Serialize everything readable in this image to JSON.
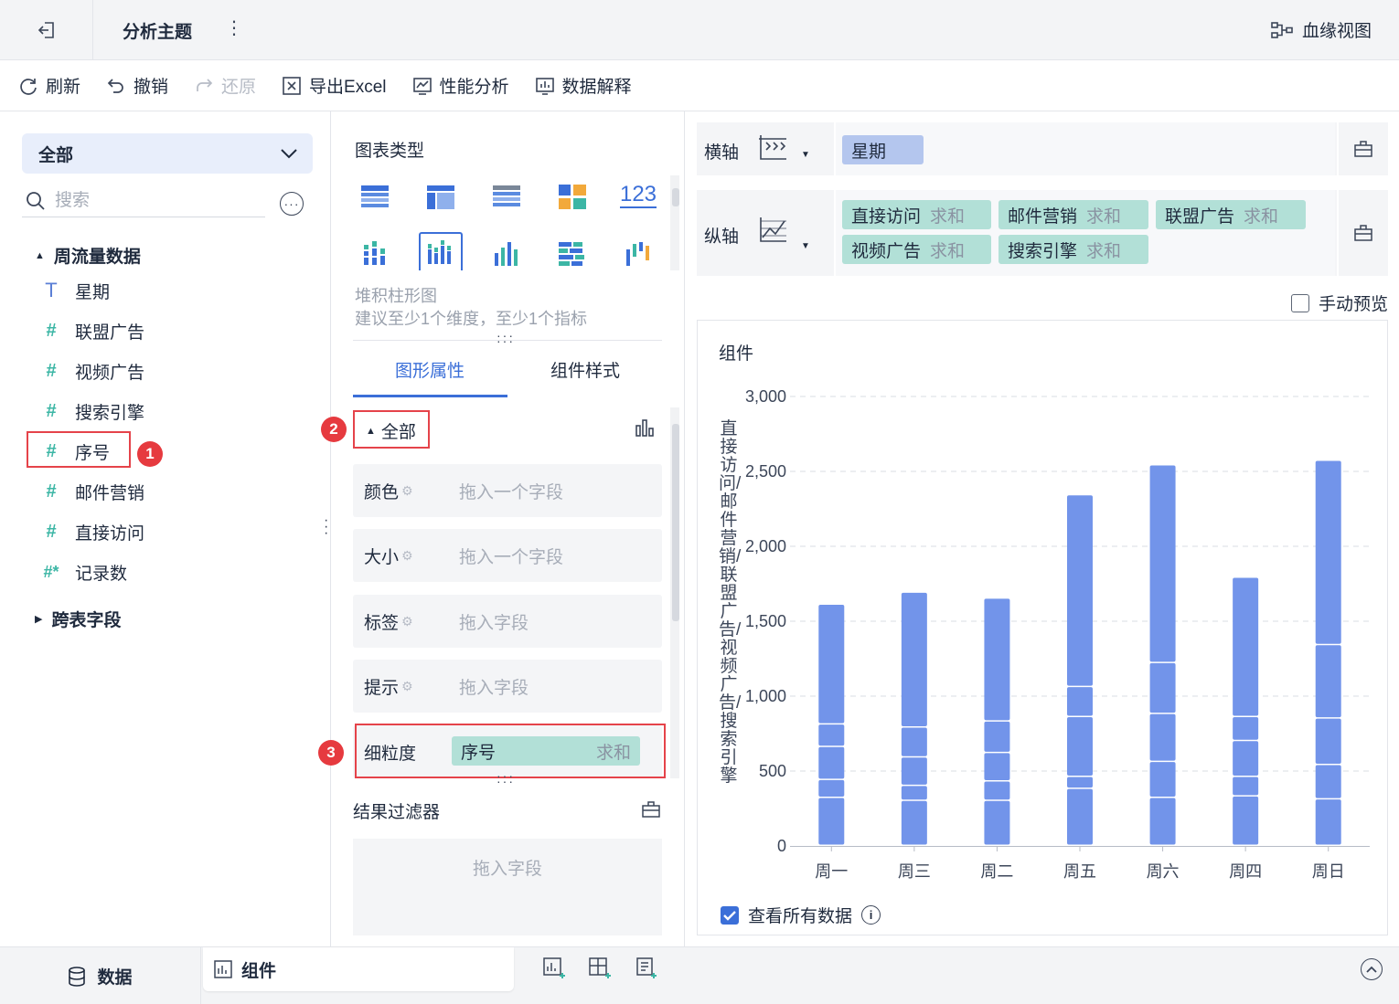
{
  "header": {
    "title": "分析主题",
    "more": "⋮",
    "lineage_label": "血缘视图"
  },
  "toolbar": {
    "refresh": "刷新",
    "undo": "撤销",
    "redo": "还原",
    "export": "导出Excel",
    "perf": "性能分析",
    "explain": "数据解释"
  },
  "left": {
    "scope": "全部",
    "search_placeholder": "搜索",
    "group1": "周流量数据",
    "fields": [
      {
        "icon": "T",
        "label": "星期"
      },
      {
        "icon": "#",
        "label": "联盟广告"
      },
      {
        "icon": "#",
        "label": "视频广告"
      },
      {
        "icon": "#",
        "label": "搜索引擎"
      },
      {
        "icon": "#",
        "label": "序号"
      },
      {
        "icon": "#",
        "label": "邮件营销"
      },
      {
        "icon": "#",
        "label": "直接访问"
      },
      {
        "icon": "#*",
        "label": "记录数"
      }
    ],
    "group2": "跨表字段"
  },
  "annotations": {
    "b1": "1",
    "b2": "2",
    "b3": "3"
  },
  "mid": {
    "chart_type_title": "图表类型",
    "chart_icons": [
      "table-icon",
      "cross-table-icon",
      "detail-table-icon",
      "kpi-card-icon",
      "number-icon",
      "stacked-bar-dot-icon",
      "stacked-column-icon",
      "column-icon",
      "bar-grid-icon",
      "range-column-icon"
    ],
    "number_icon_text": "123",
    "chart_name": "堆积柱形图",
    "chart_hint": "建议至少1个维度，至少1个指标",
    "tab_graphic": "图形属性",
    "tab_style": "组件样式",
    "prop_scope": "全部",
    "props": [
      {
        "label": "颜色",
        "placeholder": "拖入一个字段"
      },
      {
        "label": "大小",
        "placeholder": "拖入一个字段"
      },
      {
        "label": "标签",
        "placeholder": "拖入字段"
      },
      {
        "label": "提示",
        "placeholder": "拖入字段"
      }
    ],
    "granularity_label": "细粒度",
    "granularity_field": "序号",
    "granularity_agg": "求和",
    "filter_title": "结果过滤器",
    "filter_placeholder": "拖入字段"
  },
  "right": {
    "x_axis_label": "横轴",
    "x_field": "星期",
    "y_axis_label": "纵轴",
    "y_fields": [
      {
        "name": "直接访问",
        "agg": "求和"
      },
      {
        "name": "邮件营销",
        "agg": "求和"
      },
      {
        "name": "联盟广告",
        "agg": "求和"
      },
      {
        "name": "视频广告",
        "agg": "求和"
      },
      {
        "name": "搜索引擎",
        "agg": "求和"
      }
    ],
    "manual_preview": "手动预览",
    "view_all": "查看所有数据"
  },
  "chart_data": {
    "type": "bar",
    "stacked": true,
    "title": "组件",
    "ylabel": "直接访问/邮件营销/联盟广告/视频广告/搜索引擎",
    "xlabel": "",
    "ylim": [
      0,
      3000
    ],
    "yticks": [
      "3,000",
      "2,500",
      "2,000",
      "1,500",
      "1,000",
      "500",
      "0"
    ],
    "grid": true,
    "color": "#7294ea",
    "categories": [
      "周一",
      "周三",
      "周二",
      "周五",
      "周六",
      "周四",
      "周日"
    ],
    "segments": [
      [
        320,
        120,
        220,
        150,
        800
      ],
      [
        300,
        100,
        190,
        200,
        900
      ],
      [
        300,
        130,
        190,
        210,
        820
      ],
      [
        380,
        80,
        400,
        200,
        1280
      ],
      [
        320,
        240,
        320,
        340,
        1320
      ],
      [
        330,
        130,
        240,
        160,
        930
      ],
      [
        310,
        230,
        310,
        490,
        1230
      ]
    ]
  },
  "footer": {
    "data_tab": "数据",
    "component_tab": "组件"
  },
  "colors": {
    "accent": "#3b6fd8",
    "bar": "#7294ea",
    "teal_pill": "#b2e0d7",
    "blue_pill": "#b4c6ee",
    "highlight": "#e5434a"
  }
}
